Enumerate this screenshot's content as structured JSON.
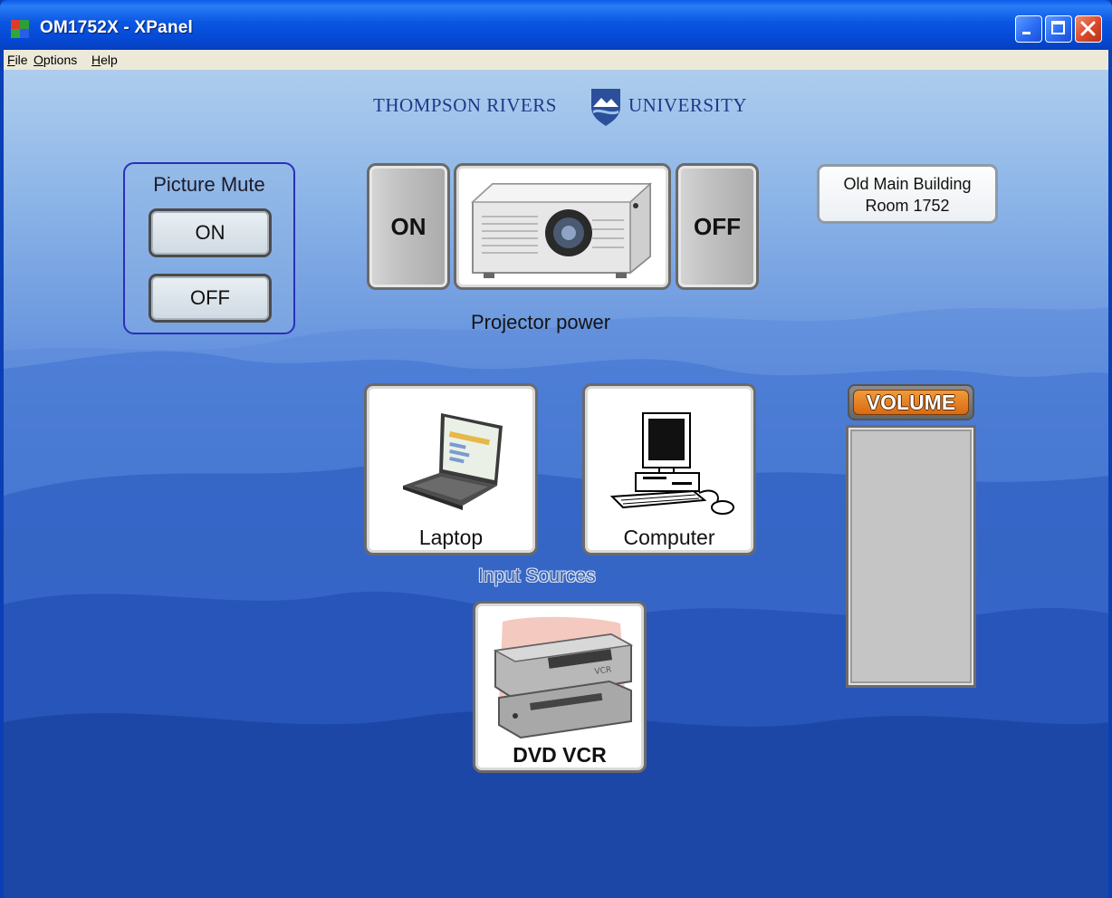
{
  "window": {
    "title": "OM1752X - XPanel",
    "controls": [
      "minimize-icon",
      "maximize-icon",
      "close-icon"
    ]
  },
  "menu": {
    "file": {
      "accel": "F",
      "rest": "ile"
    },
    "options": {
      "accel": "O",
      "rest": "ptions"
    },
    "help": {
      "accel": "H",
      "rest": "elp"
    }
  },
  "logo": {
    "left": "THOMPSON RIVERS",
    "right": "UNIVERSITY"
  },
  "picture_mute": {
    "title": "Picture Mute",
    "on": "ON",
    "off": "OFF"
  },
  "projector": {
    "on": "ON",
    "off": "OFF",
    "label": "Projector power"
  },
  "room": {
    "line1": "Old Main Building",
    "line2": "Room 1752"
  },
  "sources": {
    "laptop": "Laptop",
    "computer": "Computer",
    "dvd_vcr": "DVD VCR",
    "group_label": "Input Sources"
  },
  "volume": {
    "label": "VOLUME"
  },
  "colors": {
    "titlebar": "#0a56e2",
    "mute_border": "#2a2fb8",
    "volume_orange": "#e07a1e",
    "sky_top": "#aecdee",
    "mountain_dark": "#193f9c"
  }
}
